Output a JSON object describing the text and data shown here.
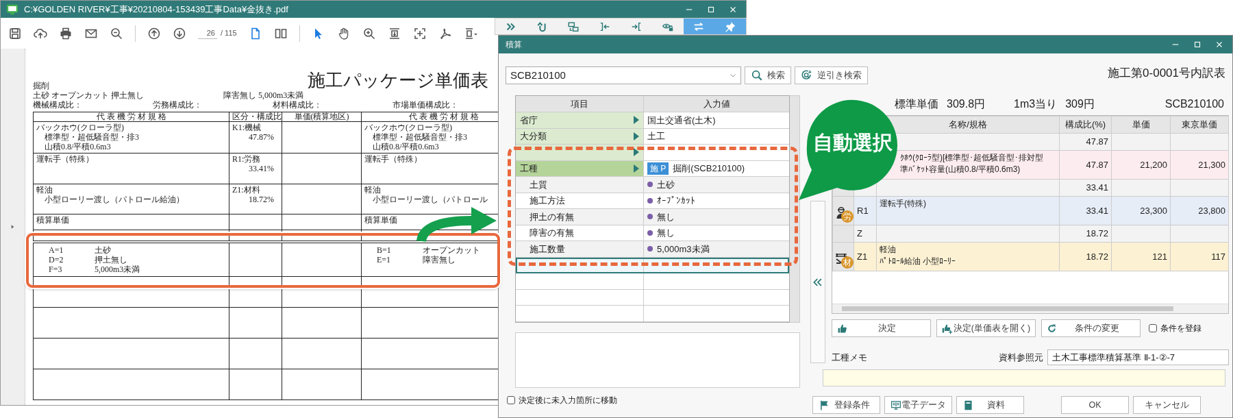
{
  "pdf_window": {
    "title": "C:¥GOLDEN RIVER¥工事¥20210804-153439工事Data¥金抜き.pdf",
    "page": "26",
    "page_total": "/ 115",
    "layouts": [
      {
        "selected": true
      },
      {
        "selected": false
      }
    ],
    "tools": [
      {
        "selected": true
      },
      {
        "selected": false
      },
      {
        "selected": false
      },
      {
        "selected": false
      },
      {
        "selected": false
      },
      {
        "selected": false
      },
      {
        "selected": false
      }
    ]
  },
  "pdf_page": {
    "title": "施工パッケージ単価表",
    "work": "掘削",
    "conditions": [
      "土砂 オープンカット 押土無し",
      "障害無し 5,000m3未満"
    ],
    "ratios": [
      "機械構成比：",
      "労務構成比：",
      "材料構成比：",
      "市場単価構成比："
    ],
    "columns": [
      "代 表 機 労 材 規 格",
      "区分・構成比",
      "単価(積算地区)",
      "代 表 機 労 材 規 格"
    ],
    "rows": [
      {
        "cells": [
          [
            "バックホウ(クローラ型)",
            "標準型・超低騒音型・排3",
            "山積0.8/平積0.6m3"
          ],
          [
            "K1:機械",
            "47.87%"
          ],
          [],
          [
            "バックホウ(クローラ型)",
            "標準型・超低騒音型・排3",
            "山積0.8/平積0.6m3"
          ]
        ]
      },
      {
        "cells": [
          [
            "運転手（特殊）"
          ],
          [
            "R1:労務",
            "33.41%"
          ],
          [],
          [
            "運転手（特殊）"
          ]
        ]
      },
      {
        "cells": [
          [
            "軽油",
            "小型ローリー渡し（パトロール給油）"
          ],
          [
            "Z1:材料",
            "18.72%"
          ],
          [],
          [
            "軽油",
            "小型ローリー渡し（パトロール"
          ]
        ]
      },
      {
        "cells": [
          [
            "積算単価"
          ],
          [],
          [],
          [
            "積算単価"
          ]
        ]
      }
    ],
    "codes": [
      [
        {
          "code": "A=1",
          "value": "土砂"
        },
        {
          "code": "D=2",
          "value": "押土無し"
        },
        {
          "code": "F=3",
          "value": "5,000m3未満"
        }
      ],
      [
        {
          "code": "B=1",
          "value": "オープンカット"
        },
        {
          "code": "E=1",
          "value": "障害無し"
        }
      ]
    ]
  },
  "side_toolbar": [
    {
      "selected": false
    },
    {
      "selected": false
    },
    {
      "selected": false
    },
    {
      "selected": false
    },
    {
      "selected": false
    },
    {
      "selected": false
    },
    {
      "selected": true
    },
    {
      "selected": true
    }
  ],
  "dialog": {
    "title": "積算",
    "code": "SCB210100",
    "search_button": "検索",
    "reverse_search_button": "逆引き検索",
    "sheet_title": "施工第0-0001号内訳表",
    "conditions": {
      "columns": [
        "項目",
        "入力値"
      ],
      "rows": [
        {
          "kind": "category",
          "label": "省庁",
          "value": "国土交通省(土木)",
          "selected": false
        },
        {
          "kind": "category",
          "label": "大分類",
          "value": "土工",
          "selected": false
        },
        {
          "kind": "category",
          "selected": false
        },
        {
          "kind": "category",
          "label": "工種",
          "tag": "施 P",
          "value": "掘削(SCB210100)",
          "selected": true
        },
        {
          "kind": "condition",
          "label": "土質",
          "value": "土砂",
          "selected": false
        },
        {
          "kind": "condition",
          "label": "施工方法",
          "value": "ｵｰﾌﾟﾝｶｯﾄ",
          "selected": false
        },
        {
          "kind": "condition",
          "label": "押土の有無",
          "value": "無し",
          "selected": false
        },
        {
          "kind": "condition",
          "label": "障害の有無",
          "value": "無し",
          "selected": false
        },
        {
          "kind": "condition",
          "label": "施工数量",
          "value": "5,000m3未満",
          "selected": false
        },
        {
          "kind": "blank",
          "selected": true
        },
        {
          "kind": "blank",
          "selected": false
        },
        {
          "kind": "blank",
          "selected": false
        },
        {
          "kind": "blank",
          "selected": false
        }
      ]
    },
    "move_checkbox": {
      "label": "決定後に未入力箇所に移動",
      "checked": false
    },
    "result": {
      "standard_label": "標準単価",
      "standard_price": "309.8円",
      "per_unit_label": "1m3当り",
      "per_unit_price": "309円",
      "code": "SCB210100"
    },
    "breakdown": {
      "columns": [
        "名称/規格",
        "構成比(%)",
        "単価",
        "東京単価"
      ],
      "rows": [
        {
          "kind": "group",
          "ratio": "47.87"
        },
        {
          "kind": "machine",
          "lines": [
            "ｸﾎｳ(ｸﾛｰﾗ型)[標準型･超低騒音型･排対型",
            "準ﾊﾞｹｯﾄ容量(山積0.8/平積0.6m3)"
          ],
          "ratio": "47.87",
          "price": "21,200",
          "tokyo_price": "21,300"
        },
        {
          "kind": "group",
          "ratio": "33.41"
        },
        {
          "kind": "labor",
          "badge": "労",
          "code": "R1",
          "lines": [
            "運転手(特殊)"
          ],
          "ratio": "33.41",
          "price": "23,300",
          "tokyo_price": "23,800"
        },
        {
          "kind": "group",
          "code": "Z",
          "ratio": "18.72"
        },
        {
          "kind": "material",
          "badge": "材",
          "code": "Z1",
          "lines": [
            "軽油",
            "ﾊﾟﾄﾛｰﾙ給油 小型ﾛｰﾘｰ"
          ],
          "ratio": "18.72",
          "price": "121",
          "tokyo_price": "117"
        }
      ]
    },
    "actions": [
      {
        "label": "決定"
      },
      {
        "label": "決定(単価表を開く)"
      },
      {
        "label": "条件の変更"
      }
    ],
    "register_checkbox": {
      "label": "条件を登録",
      "checked": false
    },
    "memo_label": "工種メモ",
    "reference_label": "資料参照元",
    "reference_value": "土木工事標準積算基準 Ⅱ-1-②-7",
    "footer_buttons": [
      {
        "label": "登録条件"
      },
      {
        "label": "電子データ"
      },
      {
        "label": "資料"
      },
      {
        "label": "OK"
      },
      {
        "label": "キャンセル"
      }
    ]
  },
  "annotation": {
    "bubble": "自動選択"
  }
}
